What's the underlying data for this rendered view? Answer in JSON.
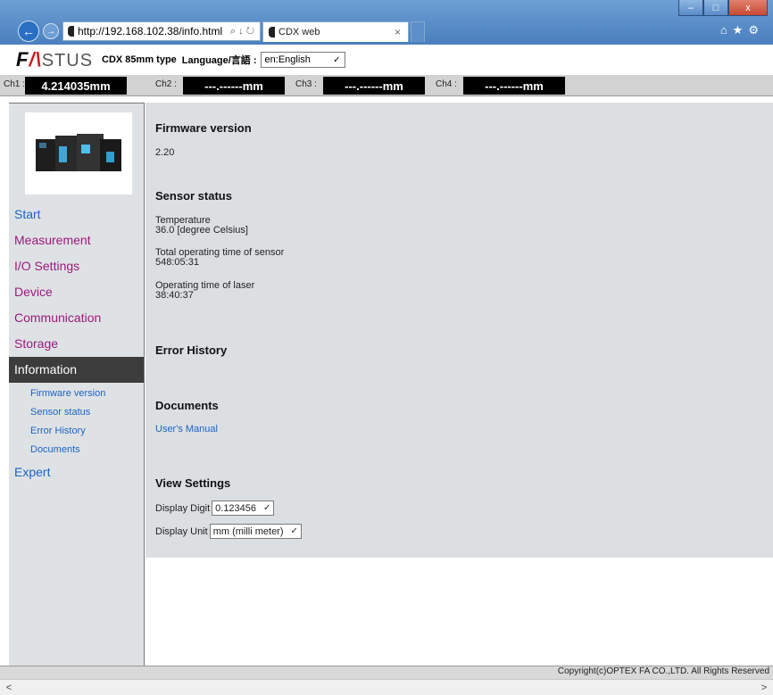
{
  "browser": {
    "address": "http://192.168.102.38/info.html",
    "address_tools": "⌕ ↓ ↻",
    "tab_title": "CDX web",
    "tab_close": "×",
    "toolbar_icons": "⌂★⚙",
    "window_min": "–",
    "window_max": "□",
    "window_close": "x"
  },
  "header": {
    "logo_f": "F",
    "logo_a": "/\\",
    "logo_rest": "STUS",
    "model": "CDX 85mm type",
    "language_label": "Language/言語 :",
    "language_value": "en:English"
  },
  "channels": [
    {
      "label": "Ch1 :",
      "value": "4.214035mm"
    },
    {
      "label": "Ch2 :",
      "value": "---.------mm"
    },
    {
      "label": "Ch3 :",
      "value": "---.------mm"
    },
    {
      "label": "Ch4 :",
      "value": "---.------mm"
    }
  ],
  "nav": {
    "start": "Start",
    "measurement": "Measurement",
    "io_settings": "I/O Settings",
    "device": "Device",
    "communication": "Communication",
    "storage": "Storage",
    "information": "Information",
    "sub": [
      "Firmware version",
      "Sensor status",
      "Error History",
      "Documents"
    ],
    "expert": "Expert"
  },
  "content": {
    "firmware_title": "Firmware version",
    "firmware_value": "2.20",
    "sensor_title": "Sensor status",
    "temperature_label": "Temperature",
    "temperature_value": "36.0 [degree Celsius]",
    "total_time_label": "Total operating time of sensor",
    "total_time_value": "548:05:31",
    "laser_time_label": "Operating time of laser",
    "laser_time_value": "38:40:37",
    "error_title": "Error History",
    "documents_title": "Documents",
    "manual_link": "User's Manual",
    "view_title": "View Settings",
    "digit_label": "Display Digit",
    "digit_value": "0.123456",
    "unit_label": "Display Unit",
    "unit_value": "mm (milli meter)"
  },
  "footer": {
    "copyright": "Copyright(c)OPTEX FA CO.,LTD. All Rights Reserved"
  },
  "scrollbar": {
    "left": "<",
    "right": ">"
  }
}
